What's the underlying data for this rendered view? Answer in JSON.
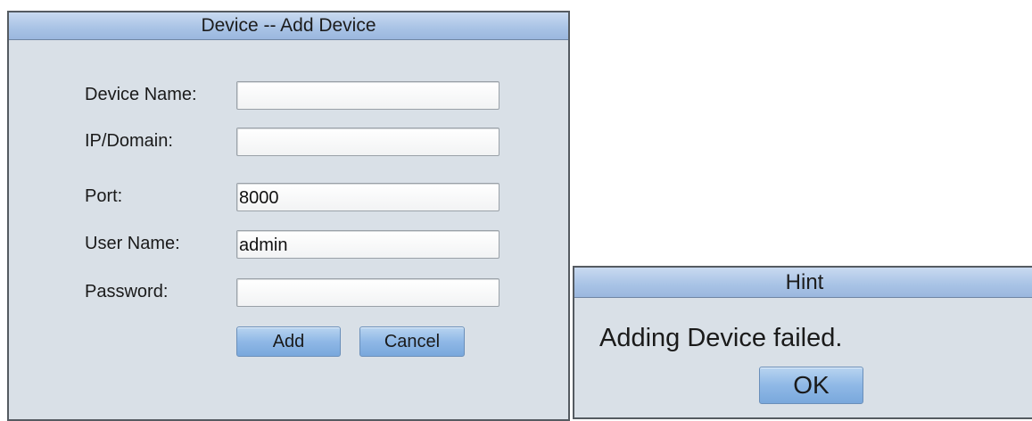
{
  "add_device_dialog": {
    "title": "Device -- Add Device",
    "fields": [
      {
        "label": "Device Name:",
        "value": ""
      },
      {
        "label": "IP/Domain:",
        "value": ""
      },
      {
        "label": "Port:",
        "value": "8000"
      },
      {
        "label": "User Name:",
        "value": "admin"
      },
      {
        "label": "Password:",
        "value": ""
      }
    ],
    "add_label": "Add",
    "cancel_label": "Cancel"
  },
  "hint_dialog": {
    "title": "Hint",
    "message": "Adding Device failed.",
    "ok_label": "OK"
  }
}
